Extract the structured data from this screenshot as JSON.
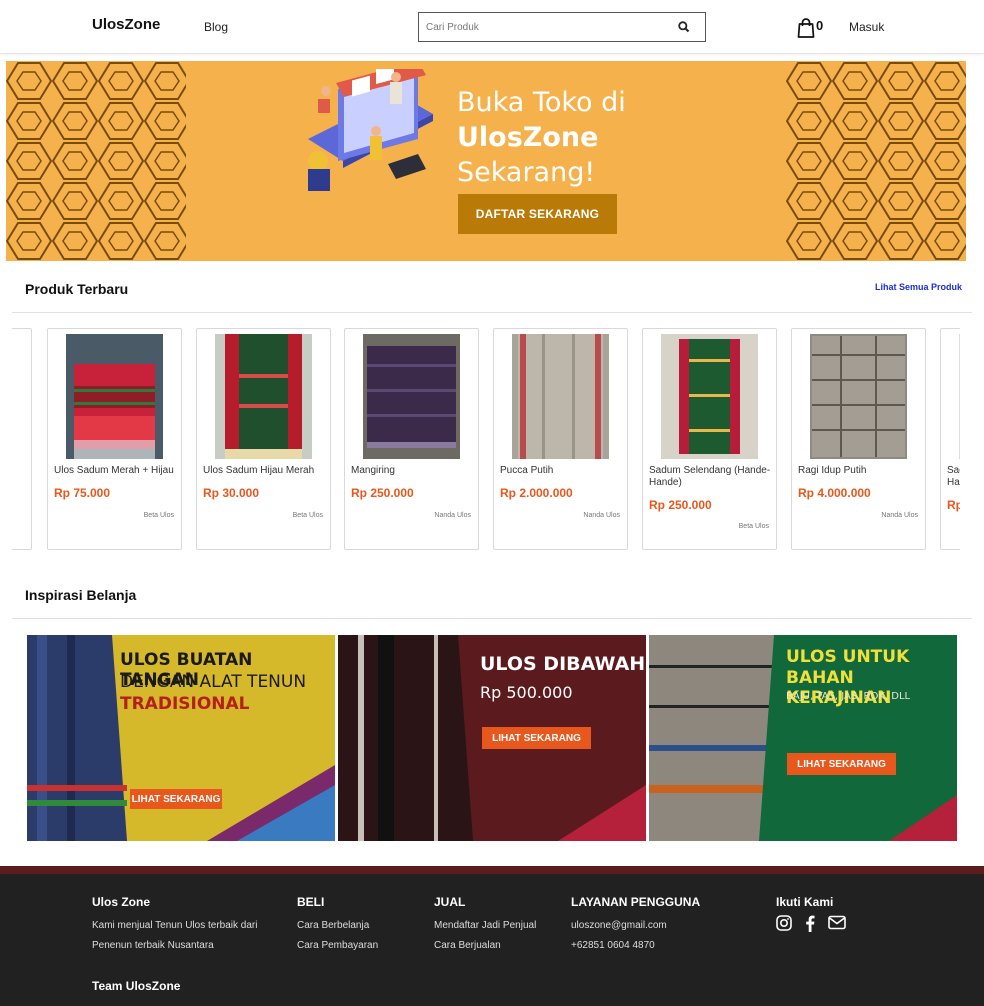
{
  "header": {
    "logo": "UlosZone",
    "blog_label": "Blog",
    "search_placeholder": "Cari Produk",
    "cart_count": "0",
    "login_label": "Masuk"
  },
  "banner": {
    "line1": "Buka Toko di",
    "line2": "UlosZone",
    "line3": "Sekarang!",
    "button_label": "DAFTAR SEKARANG"
  },
  "latest": {
    "title": "Produk Terbaru",
    "see_all": "Lihat Semua Produk",
    "products": [
      {
        "name": "Ulos Sadum Merah + Hijau",
        "price": "Rp 75.000",
        "seller": "Beta Ulos"
      },
      {
        "name": "Ulos Sadum Hijau Merah",
        "price": "Rp 30.000",
        "seller": "Beta Ulos"
      },
      {
        "name": "Mangiring",
        "price": "Rp 250.000",
        "seller": "Nanda Ulos"
      },
      {
        "name": "Pucca Putih",
        "price": "Rp 2.000.000",
        "seller": "Nanda Ulos"
      },
      {
        "name": "Sadum Selendang (Hande-Hande)",
        "price": "Rp 250.000",
        "seller": "Beta Ulos"
      },
      {
        "name": "Ragi Idup Putih",
        "price": "Rp 4.000.000",
        "seller": "Nanda Ulos"
      },
      {
        "name": "Sadum Selendang (Hande-Hande)",
        "price": "Rp",
        "seller": ""
      }
    ]
  },
  "inspiration": {
    "title": "Inspirasi Belanja",
    "cards": [
      {
        "l1": "ULOS BUATAN TANGAN",
        "l2": "DENGAN ALAT TENUN",
        "l3": "TRADISIONAL",
        "button": "LIHAT SEKARANG"
      },
      {
        "l1": "ULOS DIBAWAH",
        "l2": "Rp 500.000",
        "button": "LIHAT SEKARANG"
      },
      {
        "l1": "ULOS UNTUK",
        "l2": "BAHAN KERAJINAN",
        "l3": "BAJU, TAS, JAS, ROK, DLL",
        "button": "LIHAT SEKARANG"
      }
    ]
  },
  "footer": {
    "about_title": "Ulos Zone",
    "about_line1": "Kami menjual Tenun Ulos terbaik dari",
    "about_line2": "Penenun terbaik Nusantara",
    "team": "Team UlosZone",
    "buy_title": "BELI",
    "buy_links": [
      "Cara Berbelanja",
      "Cara Pembayaran"
    ],
    "sell_title": "JUAL",
    "sell_links": [
      "Mendaftar Jadi Penjual",
      "Cara Berjualan"
    ],
    "service_title": "LAYANAN PENGGUNA",
    "email": "uloszone@gmail.com",
    "phone": "+62851 0604 4870",
    "follow_title": "Ikuti Kami",
    "social_icons": [
      "instagram-icon",
      "facebook-icon",
      "mail-icon"
    ]
  },
  "colors": {
    "banner_bg": "#f5b14c",
    "banner_button": "#b97a08",
    "price": "#e8571c",
    "link": "#1a2fd0",
    "footer_bg": "#212121",
    "footer_stripe": "#5a1c1c"
  }
}
